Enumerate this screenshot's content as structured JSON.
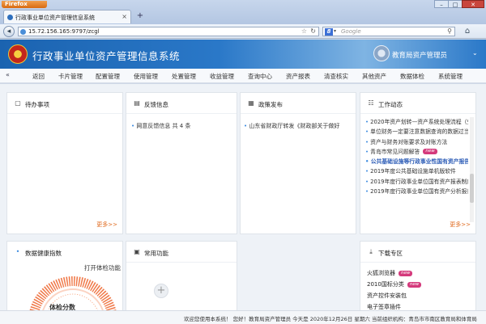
{
  "browser": {
    "menu_button": "Firefox",
    "tab_title": "行政事业单位资产管理信息系统",
    "url": "15.72.156.165:9797/zcgl",
    "search_placeholder": "Google",
    "search_engine_letter": "8"
  },
  "header": {
    "title": "行政事业单位资产管理信息系统",
    "user_name": "教育局资产管理员"
  },
  "menu": {
    "items": [
      "返回",
      "卡片管理",
      "配置管理",
      "使用管理",
      "处置管理",
      "收益管理",
      "查询中心",
      "资产报表",
      "清查核实",
      "其他资产",
      "数据体检",
      "系统管理"
    ]
  },
  "cards": {
    "todo": {
      "title": "待办事项",
      "more": "更多>>"
    },
    "feedback": {
      "title": "反馈信息",
      "line": "网意反馈信息 共 4 条"
    },
    "policy": {
      "title": "政策发布",
      "line": "山东省财政厅转发《财政部关于做好"
    },
    "work": {
      "title": "工作动态",
      "more": "更多>>",
      "badge": "new",
      "items": [
        {
          "text": "2020年资产划转—资产系统处理流程（鬼",
          "highlight": false,
          "new": false
        },
        {
          "text": "单位财务一定要注意数据查询的数据过当期",
          "highlight": false,
          "new": false
        },
        {
          "text": "资产与财务对账要求及对账方法",
          "highlight": false,
          "new": false
        },
        {
          "text": "青岛市常见问题解答",
          "highlight": false,
          "new": true
        },
        {
          "text": "公共基础设施等行政事业性国有资产报告",
          "highlight": true,
          "new": false
        },
        {
          "text": "2019年度公共基础设施单机版软件",
          "highlight": false,
          "new": false
        },
        {
          "text": "2019年度行政事业单位国有资产报表制度",
          "highlight": false,
          "new": false
        },
        {
          "text": "2019年度行政事业单位国有资产分析报告",
          "highlight": false,
          "new": false
        }
      ]
    },
    "health": {
      "title": "数据健康指数",
      "open": "打开体检功能",
      "gauge_text": "体检分数"
    },
    "functions": {
      "title": "常用功能",
      "add": "+"
    },
    "downloads": {
      "title": "下载专区",
      "badge": "new",
      "items": [
        {
          "text": "火狐浏览器",
          "new": true
        },
        {
          "text": "2010国标分类",
          "new": true
        },
        {
          "text": "资产控件安装包",
          "new": false
        },
        {
          "text": "电子签章插件",
          "new": false
        }
      ]
    }
  },
  "status": {
    "text": "欢迎您使用本系统！ 您好！教育局资产管理员  今天是 2020年12月26日 星期六    当前组织机构：青岛市市南区教育局和体育局"
  },
  "colors": {
    "header_blue": "#1b63b0",
    "accent_orange": "#e06a1e",
    "new_badge": "#d43a7c",
    "highlight_link": "#2b5bb6"
  }
}
